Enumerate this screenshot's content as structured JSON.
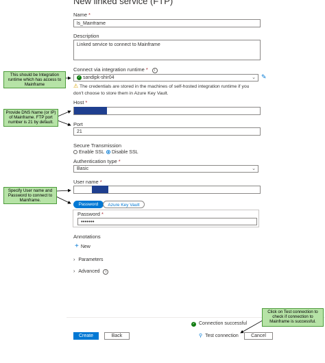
{
  "title": "New linked service (FTP)",
  "name": {
    "label": "Name",
    "required": "*",
    "value": "ls_Mainframe"
  },
  "description": {
    "label": "Description",
    "value": "Linked service to connect to Mainframe"
  },
  "ir": {
    "label": "Connect via integration runtime",
    "required": "*",
    "info_icon": "info-icon",
    "value": "sandipk-shir04",
    "warning": "The credentials are stored in the machines of self-hosted integration runtime if you don't choose to store them in Azure Key Vault."
  },
  "host": {
    "label": "Host",
    "required": "*"
  },
  "port": {
    "label": "Port",
    "value": "21"
  },
  "transmission": {
    "label": "Secure Transmission",
    "enable": "Enable SSL",
    "disable": "Disable SSL"
  },
  "auth": {
    "label": "Authentication type",
    "required": "*",
    "value": "Basic"
  },
  "username": {
    "label": "User name",
    "required": "*"
  },
  "password_tabs": {
    "password": "Password",
    "keyvault": "Azure Key Vault"
  },
  "password": {
    "label": "Password",
    "required": "*",
    "value": "•••••••"
  },
  "annotations": {
    "label": "Annotations",
    "new": "New"
  },
  "parameters": {
    "label": "Parameters"
  },
  "advanced": {
    "label": "Advanced"
  },
  "status": {
    "text": "Connection successful"
  },
  "footer": {
    "create": "Create",
    "back": "Back",
    "test": "Test connection",
    "cancel": "Cancel"
  },
  "notes": {
    "ir": "This should be Integration runtime which has access to Mainframe",
    "host": "Provide DNS Name (or IP) of Mainframe. FTP port number is 21 by default.",
    "creds": "Specify User name and Password to connect to Mainframe.",
    "test": "Click on Test connection to check if connection to Mainframe is successful."
  },
  "colors": {
    "accent": "#0078d4",
    "success": "#107c10",
    "warning": "#d9a300",
    "note_bg": "#b6e3a6",
    "redact": "#1f3f8f"
  }
}
